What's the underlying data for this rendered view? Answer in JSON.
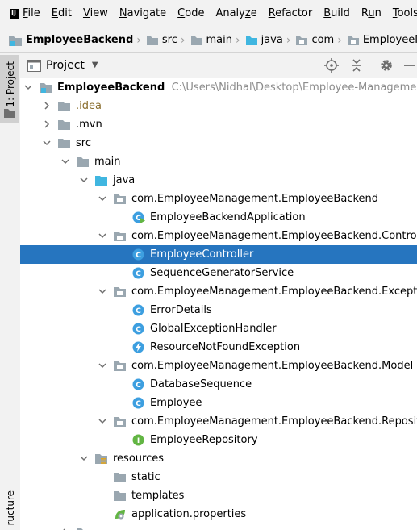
{
  "menu": {
    "items": [
      {
        "mnemonic": "F",
        "rest": "ile"
      },
      {
        "mnemonic": "E",
        "rest": "dit"
      },
      {
        "mnemonic": "V",
        "rest": "iew"
      },
      {
        "mnemonic": "N",
        "rest": "avigate"
      },
      {
        "mnemonic": "C",
        "rest": "ode"
      },
      {
        "pre": "Analy",
        "mnemonic": "z",
        "rest": "e"
      },
      {
        "mnemonic": "R",
        "rest": "efactor"
      },
      {
        "mnemonic": "B",
        "rest": "uild"
      },
      {
        "pre": "R",
        "mnemonic": "u",
        "rest": "n"
      },
      {
        "mnemonic": "T",
        "rest": "ools"
      }
    ]
  },
  "breadcrumb": [
    "EmployeeBackend",
    "src",
    "main",
    "java",
    "com",
    "EmployeeManage"
  ],
  "left_strip": {
    "project_tab": "1: Project",
    "structure_tab": "ructure"
  },
  "panel": {
    "title": "Project"
  },
  "tree": {
    "root_label": "EmployeeBackend",
    "root_path": "C:\\Users\\Nidhal\\Desktop\\Employee-Management-Applic",
    "idea": ".idea",
    "mvn": ".mvn",
    "src": "src",
    "main": "main",
    "java": "java",
    "pkg_root": "com.EmployeeManagement.EmployeeBackend",
    "app_class": "EmployeeBackendApplication",
    "pkg_controller": "com.EmployeeManagement.EmployeeBackend.Controller",
    "employee_controller": "EmployeeController",
    "sequence_service": "SequenceGeneratorService",
    "pkg_exception": "com.EmployeeManagement.EmployeeBackend.Exception",
    "error_details": "ErrorDetails",
    "global_handler": "GlobalExceptionHandler",
    "not_found_exception": "ResourceNotFoundException",
    "pkg_model": "com.EmployeeManagement.EmployeeBackend.Model",
    "database_sequence": "DatabaseSequence",
    "employee": "Employee",
    "pkg_repository": "com.EmployeeManagement.EmployeeBackend.Repository",
    "employee_repository": "EmployeeRepository",
    "resources": "resources",
    "static": "static",
    "templates": "templates",
    "app_properties": "application.properties"
  },
  "colors": {
    "selection": "#2675bf",
    "class_icon": "#3d9fe0",
    "interface_icon": "#62b543",
    "folder": "#9aa7b0",
    "source_folder": "#40b6e0"
  }
}
